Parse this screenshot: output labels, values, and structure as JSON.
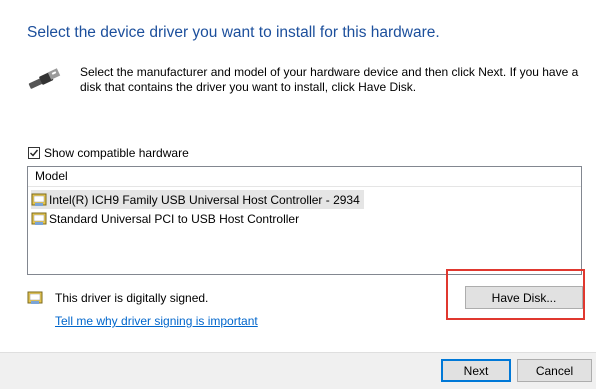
{
  "heading": "Select the device driver you want to install for this hardware.",
  "description": "Select the manufacturer and model of your hardware device and then click Next. If you have a disk that contains the driver you want to install, click Have Disk.",
  "show_compatible": {
    "label": "Show compatible hardware",
    "checked": true
  },
  "model_list": {
    "header": "Model",
    "items": [
      {
        "label": "Intel(R) ICH9 Family USB Universal Host Controller - 2934",
        "selected": true,
        "icon": "driver-icon"
      },
      {
        "label": "Standard Universal PCI to USB Host Controller",
        "selected": false,
        "icon": "driver-icon"
      }
    ]
  },
  "signing": {
    "status": "This driver is digitally signed.",
    "link": "Tell me why driver signing is important"
  },
  "buttons": {
    "have_disk": "Have Disk...",
    "next": "Next",
    "cancel": "Cancel"
  },
  "colors": {
    "heading": "#1c4f9c",
    "link": "#0066cc",
    "highlight": "#e0382f",
    "focus": "#0078d7"
  }
}
